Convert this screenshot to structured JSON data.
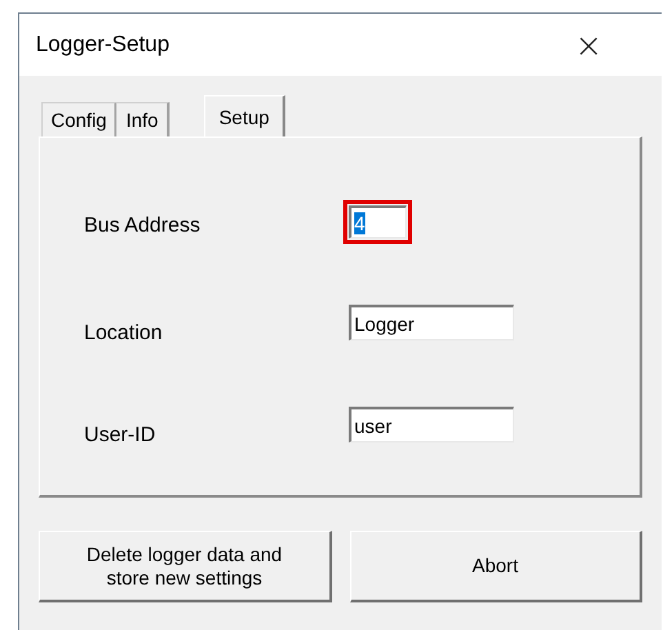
{
  "window": {
    "title": "Logger-Setup",
    "close": "×"
  },
  "tabs": [
    {
      "label": "Config",
      "selected": false
    },
    {
      "label": "Info",
      "selected": false
    },
    {
      "label": "Setup",
      "selected": true
    }
  ],
  "fields": [
    {
      "label": "Bus Address",
      "value": "4",
      "highlighted": true,
      "text_selected": true,
      "kind": "short"
    },
    {
      "label": "Location",
      "value": "Logger",
      "highlighted": false,
      "text_selected": false,
      "kind": "long"
    },
    {
      "label": "User-ID",
      "value": "user",
      "highlighted": false,
      "text_selected": false,
      "kind": "long"
    }
  ],
  "buttons": [
    "Delete logger data and store new settings",
    "Abort"
  ]
}
